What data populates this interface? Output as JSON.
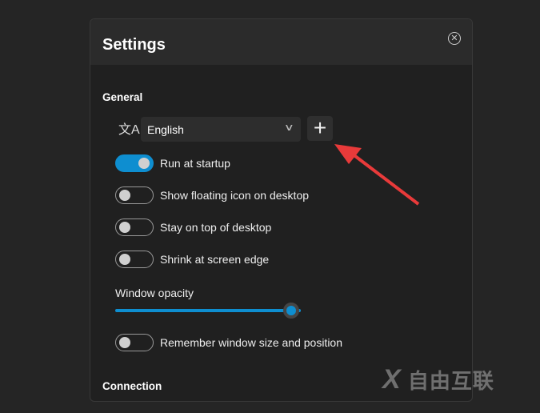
{
  "dialog": {
    "title": "Settings",
    "close_icon": "close-circle-icon"
  },
  "general": {
    "heading": "General",
    "language": {
      "icon": "translate-icon",
      "icon_glyph": "文A",
      "value": "English",
      "add_icon": "plus-icon"
    },
    "toggles": [
      {
        "label": "Run at startup",
        "on": true
      },
      {
        "label": "Show floating icon on desktop",
        "on": false
      },
      {
        "label": "Stay on top of desktop",
        "on": false
      },
      {
        "label": "Shrink at screen edge",
        "on": false
      }
    ],
    "opacity": {
      "label": "Window opacity",
      "value_percent": 95
    },
    "remember": {
      "label": "Remember window size and position",
      "on": false
    }
  },
  "connection": {
    "heading": "Connection"
  },
  "watermark": {
    "text": "自由互联"
  },
  "colors": {
    "accent": "#0e8ed0",
    "annotation_arrow": "#e83a3a"
  }
}
